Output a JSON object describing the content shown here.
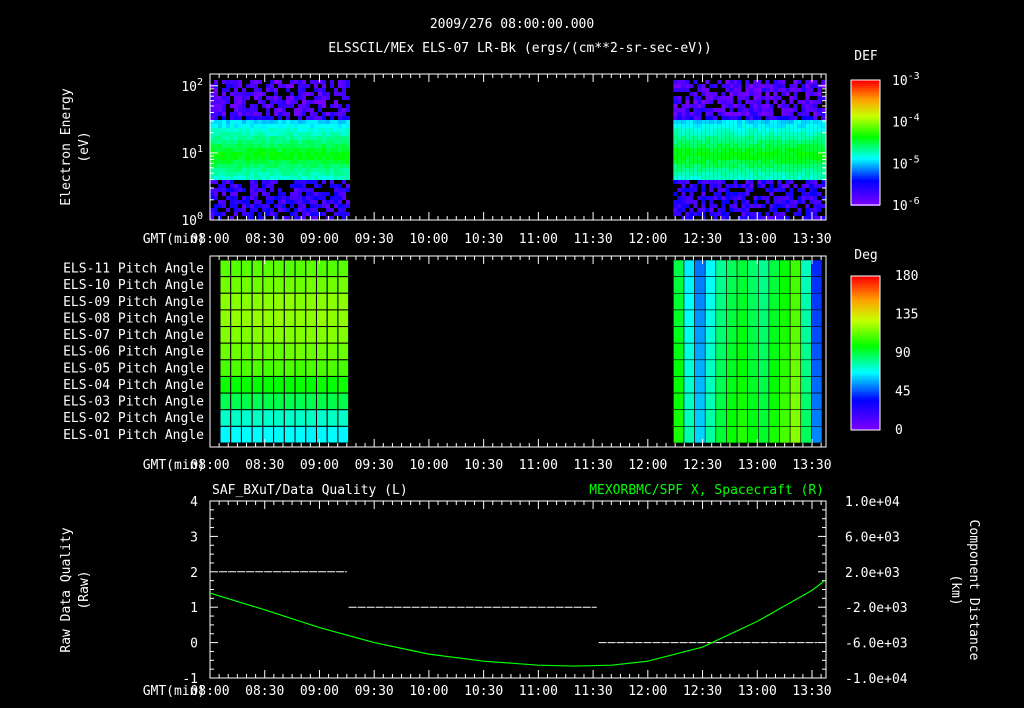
{
  "header": {
    "time": "2009/276 08:00:00.000",
    "title": "ELSSCIL/MEx ELS-07 LR-Bk  (ergs/(cm**2-sr-sec-eV))"
  },
  "colors": {
    "background": "#000000",
    "axes": "#ffffff",
    "curve": "#00ff00"
  },
  "chart_data": [
    {
      "type": "heatmap",
      "ylabel": [
        "Electron Energy",
        "(eV)"
      ],
      "xlabel": "GMT(min)",
      "yscale": "log",
      "ylim": [
        1,
        150
      ],
      "ytick_labels": [
        {
          "base": "10",
          "exp": "0",
          "v": 1
        },
        {
          "base": "10",
          "exp": "1",
          "v": 10
        },
        {
          "base": "10",
          "exp": "2",
          "v": 100
        }
      ],
      "x_tick_labels": [
        "08:00",
        "08:30",
        "09:00",
        "09:30",
        "10:00",
        "10:30",
        "11:00",
        "11:30",
        "12:00",
        "12:30",
        "13:00",
        "13:30"
      ],
      "data_intervals": [
        [
          "08:00",
          "09:16"
        ],
        [
          "12:14",
          "13:37"
        ]
      ],
      "peak_energy_eV": [
        4,
        35
      ],
      "colorbar": {
        "label": "DEF",
        "scale": "log",
        "range": [
          1e-06,
          0.001
        ],
        "tick_labels": [
          {
            "base": "10",
            "exp": "-3"
          },
          {
            "base": "10",
            "exp": "-4"
          },
          {
            "base": "10",
            "exp": "-5"
          },
          {
            "base": "10",
            "exp": "-6"
          }
        ]
      }
    },
    {
      "type": "heatmap",
      "xlabel": "GMT(min)",
      "row_labels": [
        "ELS-11 Pitch Angle",
        "ELS-10 Pitch Angle",
        "ELS-09 Pitch Angle",
        "ELS-08 Pitch Angle",
        "ELS-07 Pitch Angle",
        "ELS-06 Pitch Angle",
        "ELS-05 Pitch Angle",
        "ELS-04 Pitch Angle",
        "ELS-03 Pitch Angle",
        "ELS-02 Pitch Angle",
        "ELS-01 Pitch Angle"
      ],
      "x_tick_labels": [
        "08:00",
        "08:30",
        "09:00",
        "09:30",
        "10:00",
        "10:30",
        "11:00",
        "11:30",
        "12:00",
        "12:30",
        "13:00",
        "13:30"
      ],
      "data_intervals": [
        [
          "08:00",
          "09:16"
        ],
        [
          "12:14",
          "13:37"
        ]
      ],
      "first_interval_row_values_deg": [
        112,
        116,
        120,
        121,
        119,
        115,
        110,
        100,
        90,
        75,
        68
      ],
      "second_interval_column_values_deg": [
        95,
        70,
        55,
        72,
        85,
        92,
        96,
        90,
        86,
        95,
        102,
        112,
        80,
        45
      ],
      "colorbar": {
        "label": "Deg",
        "range": [
          0,
          180
        ],
        "tick_labels": [
          "180",
          "135",
          "90",
          "45",
          "0"
        ]
      }
    },
    {
      "type": "line",
      "title_left": "SAF_BXuT/Data Quality (L)",
      "title_right": "MEXORBMC/SPF X, Spacecraft (R)",
      "ylabel_left": [
        "Raw Data Quality",
        "(Raw)"
      ],
      "ylabel_right": [
        "Component Distance",
        "(km)"
      ],
      "xlabel": "GMT(min)",
      "ylim_left": [
        -1,
        4
      ],
      "ylim_right": [
        -10000,
        10000
      ],
      "ytick_labels_left": [
        "4",
        "3",
        "2",
        "1",
        "0",
        "-1"
      ],
      "ytick_labels_right": [
        "1.0e+04",
        "6.0e+03",
        "2.0e+03",
        "-2.0e+03",
        "-6.0e+03",
        "-1.0e+04"
      ],
      "x_tick_labels": [
        "08:00",
        "08:30",
        "09:00",
        "09:30",
        "10:00",
        "10:30",
        "11:00",
        "11:30",
        "12:00",
        "12:30",
        "13:00",
        "13:30"
      ],
      "quality_segments": [
        {
          "start": "08:05",
          "end": "09:15",
          "value": 2
        },
        {
          "start": "09:16",
          "end": "11:32",
          "value": 1
        },
        {
          "start": "11:33",
          "end": "13:33",
          "value": 0
        }
      ],
      "spacecraft_x_km": {
        "times": [
          "08:00",
          "08:30",
          "09:00",
          "09:30",
          "10:00",
          "10:30",
          "11:00",
          "11:20",
          "11:40",
          "12:00",
          "12:30",
          "13:00",
          "13:30",
          "13:37"
        ],
        "values": [
          -400,
          -2300,
          -4300,
          -6000,
          -7300,
          -8100,
          -8550,
          -8650,
          -8550,
          -8100,
          -6500,
          -3600,
          -100,
          1000
        ]
      }
    }
  ]
}
